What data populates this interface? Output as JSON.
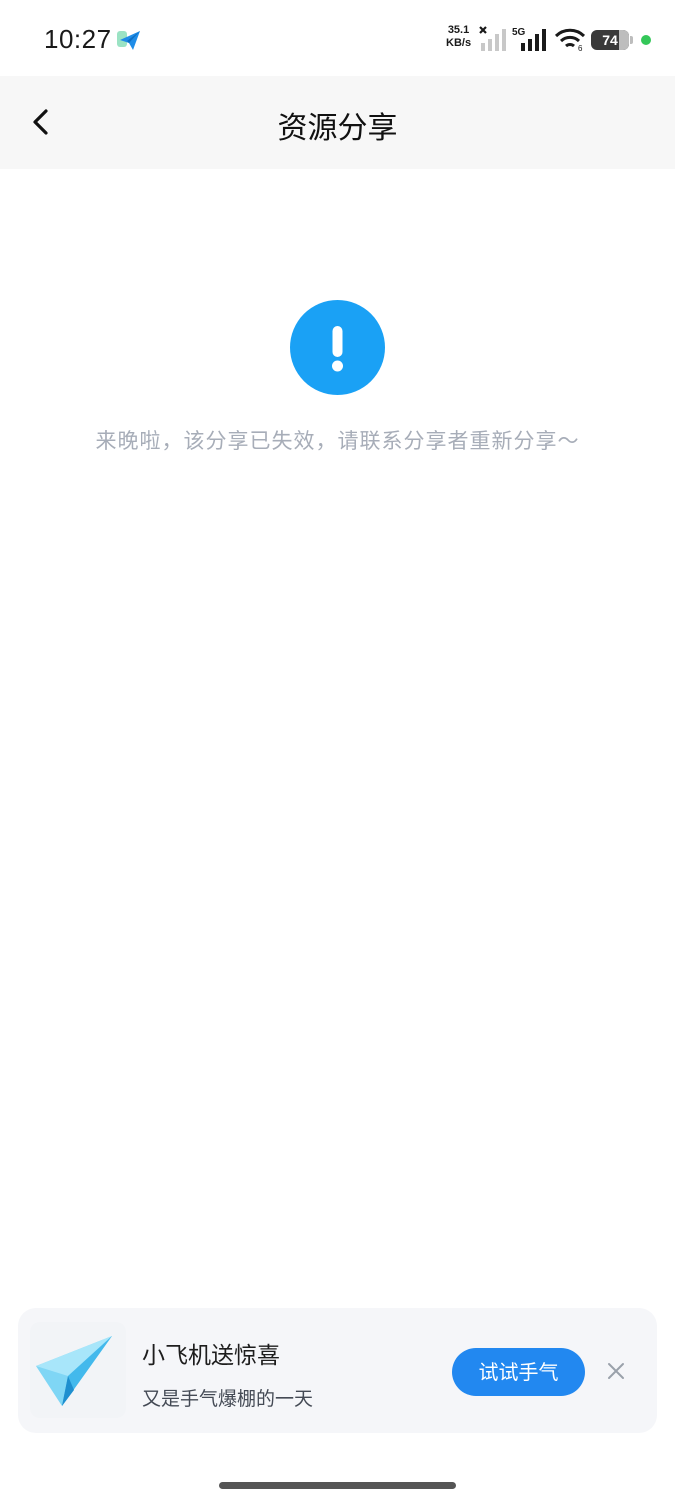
{
  "status_bar": {
    "time": "10:27",
    "network_speed_value": "35.1",
    "network_speed_unit": "KB/s",
    "network_type": "5G",
    "battery_level": 74,
    "battery_level_label": "74",
    "app_icon": "send-plane-icon",
    "indicator_color": "#34c759"
  },
  "header": {
    "title": "资源分享",
    "back_icon": "chevron-left-icon",
    "background": "#f7f7f7"
  },
  "main": {
    "alert_icon": "exclamation-circle-icon",
    "alert_color": "#1aa1f5",
    "message": "来晚啦，该分享已失效，请联系分享者重新分享～"
  },
  "promo": {
    "image_icon": "paper-plane-icon",
    "title": "小飞机送惊喜",
    "subtitle": "又是手气爆棚的一天",
    "button_label": "试试手气",
    "button_color": "#2288f0",
    "close_icon": "close-icon"
  }
}
